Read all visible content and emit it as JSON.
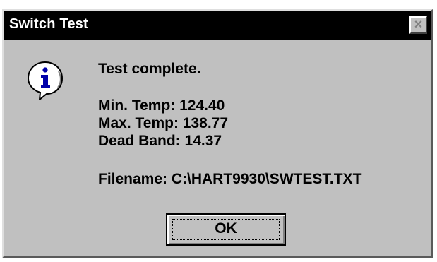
{
  "window": {
    "title": "Switch Test",
    "close_label": "×"
  },
  "message": {
    "icon": "info-icon",
    "status": "Test complete.",
    "min_temp": "Min. Temp: 124.40",
    "max_temp": "Max. Temp: 138.77",
    "dead_band": "Dead Band: 14.37",
    "filename": "Filename: C:\\HART9930\\SWTEST.TXT"
  },
  "buttons": {
    "ok_label": "OK"
  },
  "colors": {
    "titlebar": "#000000",
    "dialog_face": "#c0c0c0",
    "icon_blue": "#0000aa"
  }
}
